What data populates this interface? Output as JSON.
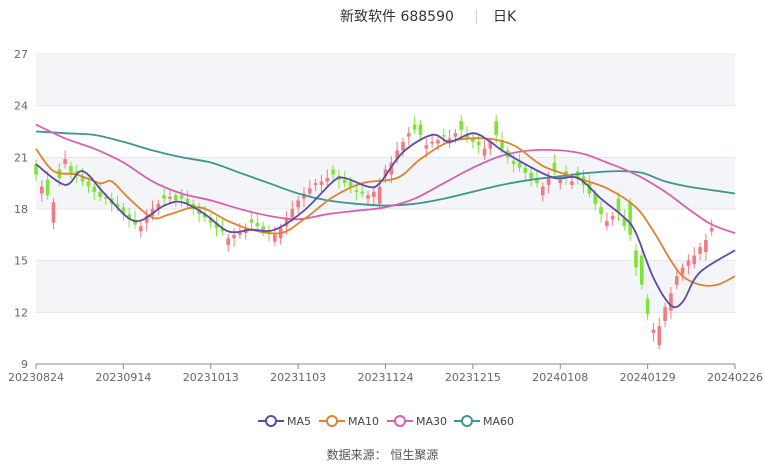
{
  "header": {
    "title": "新致软件 688590",
    "period": "日K"
  },
  "source": "数据来源： 恒生聚源",
  "legend": [
    {
      "name": "MA5",
      "color": "#5b4aa8"
    },
    {
      "name": "MA10",
      "color": "#e0822f"
    },
    {
      "name": "MA30",
      "color": "#d95fb5"
    },
    {
      "name": "MA60",
      "color": "#3e9592"
    }
  ],
  "colors": {
    "up": "#f07b82",
    "down": "#7fe33a",
    "band": "#f4f5f9"
  },
  "chart_data": {
    "type": "candlestick",
    "ylim": [
      9,
      27
    ],
    "yticks": [
      "9",
      "12",
      "15",
      "18",
      "21",
      "24",
      "27"
    ],
    "xticks": [
      {
        "label": "20230824",
        "x": 0
      },
      {
        "label": "20230914",
        "x": 15
      },
      {
        "label": "20231013",
        "x": 30
      },
      {
        "label": "20231103",
        "x": 45
      },
      {
        "label": "20231124",
        "x": 60
      },
      {
        "label": "20231215",
        "x": 75
      },
      {
        "label": "20240108",
        "x": 90
      },
      {
        "label": "20240129",
        "x": 105
      },
      {
        "label": "20240226",
        "x": 120
      }
    ],
    "x_count": 121,
    "close": [
      20.0,
      19.3,
      18.8,
      18.4,
      19.8,
      20.9,
      20.1,
      20.0,
      19.6,
      19.3,
      19.0,
      18.7,
      18.6,
      18.3,
      18.1,
      17.7,
      17.4,
      17.1,
      17.0,
      17.6,
      18.0,
      18.3,
      18.6,
      18.7,
      18.5,
      18.6,
      18.3,
      18.0,
      17.7,
      17.5,
      17.2,
      16.9,
      16.7,
      16.3,
      16.5,
      16.7,
      16.9,
      17.2,
      17.0,
      16.8,
      16.6,
      16.5,
      16.9,
      17.5,
      18.0,
      18.5,
      18.9,
      19.2,
      19.5,
      19.6,
      19.8,
      20.0,
      19.7,
      19.5,
      19.3,
      19.0,
      18.9,
      18.8,
      19.0,
      19.3,
      20.3,
      20.7,
      21.4,
      21.9,
      22.4,
      22.6,
      22.3,
      21.7,
      21.9,
      22.0,
      22.2,
      22.1,
      22.4,
      22.6,
      22.1,
      21.9,
      21.7,
      21.5,
      21.9,
      22.3,
      21.5,
      21.0,
      20.6,
      20.4,
      20.1,
      19.8,
      19.5,
      19.3,
      19.8,
      20.2,
      19.7,
      19.9,
      19.6,
      19.8,
      19.4,
      18.9,
      18.3,
      17.7,
      17.3,
      17.6,
      17.8,
      17.0,
      16.5,
      14.6,
      13.6,
      11.9,
      11.0,
      11.2,
      12.3,
      13.1,
      14.1,
      14.6,
      15.0,
      15.3,
      15.8,
      16.2,
      16.9
    ],
    "open_offsets": [
      0.6,
      -0.4,
      0.9,
      -1.2,
      0.5,
      -0.3,
      0.4,
      0.2,
      0.3,
      0.3,
      0.3,
      0.3,
      0.1,
      0.3,
      0.2,
      0.4,
      0.3,
      0.3,
      -0.3,
      -0.4,
      -0.4,
      -0.3,
      0.2,
      -0.1,
      0.3,
      0.2,
      0.3,
      0.3,
      0.3,
      0.2,
      0.3,
      0.3,
      0.2,
      -0.4,
      -0.2,
      -0.2,
      -0.3,
      0.2,
      0.2,
      0.2,
      0.1,
      -0.4,
      -0.6,
      -0.5,
      -0.5,
      -0.4,
      -0.3,
      -0.3,
      -0.1,
      -0.2,
      -0.2,
      0.3,
      0.2,
      0.2,
      0.3,
      0.1,
      0.1,
      -0.2,
      -0.3,
      -1.0,
      -0.4,
      -0.7,
      -0.5,
      -0.5,
      -0.2,
      0.3,
      0.6,
      -0.2,
      -0.1,
      -0.2,
      0.1,
      -0.3,
      -0.2,
      0.5,
      0.2,
      0.2,
      0.2,
      -0.4,
      -0.4,
      0.8,
      0.5,
      0.4,
      0.2,
      0.3,
      0.3,
      0.3,
      0.2,
      -0.5,
      -0.4,
      0.5,
      -0.2,
      0.3,
      -0.2,
      0.4,
      0.5,
      0.6,
      0.6,
      0.4,
      -0.3,
      -0.2,
      0.8,
      0.5,
      1.9,
      1.0,
      1.7,
      0.9,
      -0.2,
      -1.1,
      -0.8,
      -1.0,
      -0.5,
      -0.4,
      -0.3,
      -0.5,
      -0.4,
      -0.7,
      -0.2
    ],
    "series": [
      {
        "name": "MA5",
        "color": "#5b4aa8",
        "points": [
          [
            0,
            20.6
          ],
          [
            5,
            19.4
          ],
          [
            8,
            20.2
          ],
          [
            12,
            18.8
          ],
          [
            17,
            17.3
          ],
          [
            22,
            18.2
          ],
          [
            25,
            18.4
          ],
          [
            29,
            17.7
          ],
          [
            33,
            16.7
          ],
          [
            37,
            16.8
          ],
          [
            41,
            16.8
          ],
          [
            46,
            17.9
          ],
          [
            51,
            19.6
          ],
          [
            53,
            19.8
          ],
          [
            57,
            19.3
          ],
          [
            59,
            19.5
          ],
          [
            63,
            21.3
          ],
          [
            68,
            22.3
          ],
          [
            71,
            21.9
          ],
          [
            75,
            22.4
          ],
          [
            78,
            21.9
          ],
          [
            80,
            21.4
          ],
          [
            84,
            20.6
          ],
          [
            89,
            19.8
          ],
          [
            93,
            19.8
          ],
          [
            97,
            18.6
          ],
          [
            101,
            17.5
          ],
          [
            103,
            16.6
          ],
          [
            106,
            14.0
          ],
          [
            109,
            12.4
          ],
          [
            111,
            12.6
          ],
          [
            113,
            13.9
          ],
          [
            115,
            14.6
          ],
          [
            120,
            15.6
          ]
        ]
      },
      {
        "name": "MA10",
        "color": "#e0822f",
        "points": [
          [
            0,
            21.5
          ],
          [
            3,
            20.2
          ],
          [
            7,
            20.0
          ],
          [
            11,
            19.5
          ],
          [
            13,
            19.6
          ],
          [
            16,
            18.6
          ],
          [
            20,
            17.5
          ],
          [
            23,
            17.7
          ],
          [
            28,
            18.1
          ],
          [
            33,
            17.3
          ],
          [
            37,
            16.8
          ],
          [
            42,
            16.6
          ],
          [
            46,
            17.4
          ],
          [
            51,
            18.7
          ],
          [
            56,
            19.5
          ],
          [
            62,
            19.8
          ],
          [
            66,
            20.9
          ],
          [
            71,
            21.9
          ],
          [
            77,
            22.1
          ],
          [
            82,
            21.7
          ],
          [
            87,
            20.5
          ],
          [
            92,
            19.9
          ],
          [
            98,
            19.2
          ],
          [
            103,
            18.1
          ],
          [
            106,
            16.7
          ],
          [
            109,
            15.0
          ],
          [
            111,
            14.1
          ],
          [
            114,
            13.6
          ],
          [
            117,
            13.6
          ],
          [
            120,
            14.1
          ]
        ]
      },
      {
        "name": "MA30",
        "color": "#d95fb5",
        "points": [
          [
            0,
            22.9
          ],
          [
            5,
            22.1
          ],
          [
            10,
            21.5
          ],
          [
            15,
            20.7
          ],
          [
            20,
            19.6
          ],
          [
            25,
            18.9
          ],
          [
            30,
            18.5
          ],
          [
            35,
            18.0
          ],
          [
            40,
            17.6
          ],
          [
            45,
            17.4
          ],
          [
            50,
            17.7
          ],
          [
            55,
            17.9
          ],
          [
            60,
            18.1
          ],
          [
            65,
            18.6
          ],
          [
            70,
            19.5
          ],
          [
            75,
            20.4
          ],
          [
            80,
            21.1
          ],
          [
            85,
            21.4
          ],
          [
            90,
            21.4
          ],
          [
            94,
            21.2
          ],
          [
            98,
            20.7
          ],
          [
            103,
            20.0
          ],
          [
            108,
            19.0
          ],
          [
            112,
            18.0
          ],
          [
            116,
            17.1
          ],
          [
            120,
            16.6
          ]
        ]
      },
      {
        "name": "MA60",
        "color": "#3e9592",
        "points": [
          [
            0,
            22.5
          ],
          [
            5,
            22.4
          ],
          [
            10,
            22.3
          ],
          [
            15,
            21.9
          ],
          [
            20,
            21.4
          ],
          [
            25,
            21.0
          ],
          [
            30,
            20.7
          ],
          [
            35,
            20.1
          ],
          [
            40,
            19.5
          ],
          [
            45,
            18.9
          ],
          [
            50,
            18.5
          ],
          [
            55,
            18.3
          ],
          [
            60,
            18.2
          ],
          [
            65,
            18.3
          ],
          [
            70,
            18.6
          ],
          [
            75,
            19.0
          ],
          [
            80,
            19.4
          ],
          [
            85,
            19.7
          ],
          [
            90,
            19.9
          ],
          [
            95,
            20.1
          ],
          [
            100,
            20.2
          ],
          [
            104,
            20.1
          ],
          [
            108,
            19.6
          ],
          [
            112,
            19.3
          ],
          [
            116,
            19.1
          ],
          [
            120,
            18.9
          ]
        ]
      }
    ]
  }
}
